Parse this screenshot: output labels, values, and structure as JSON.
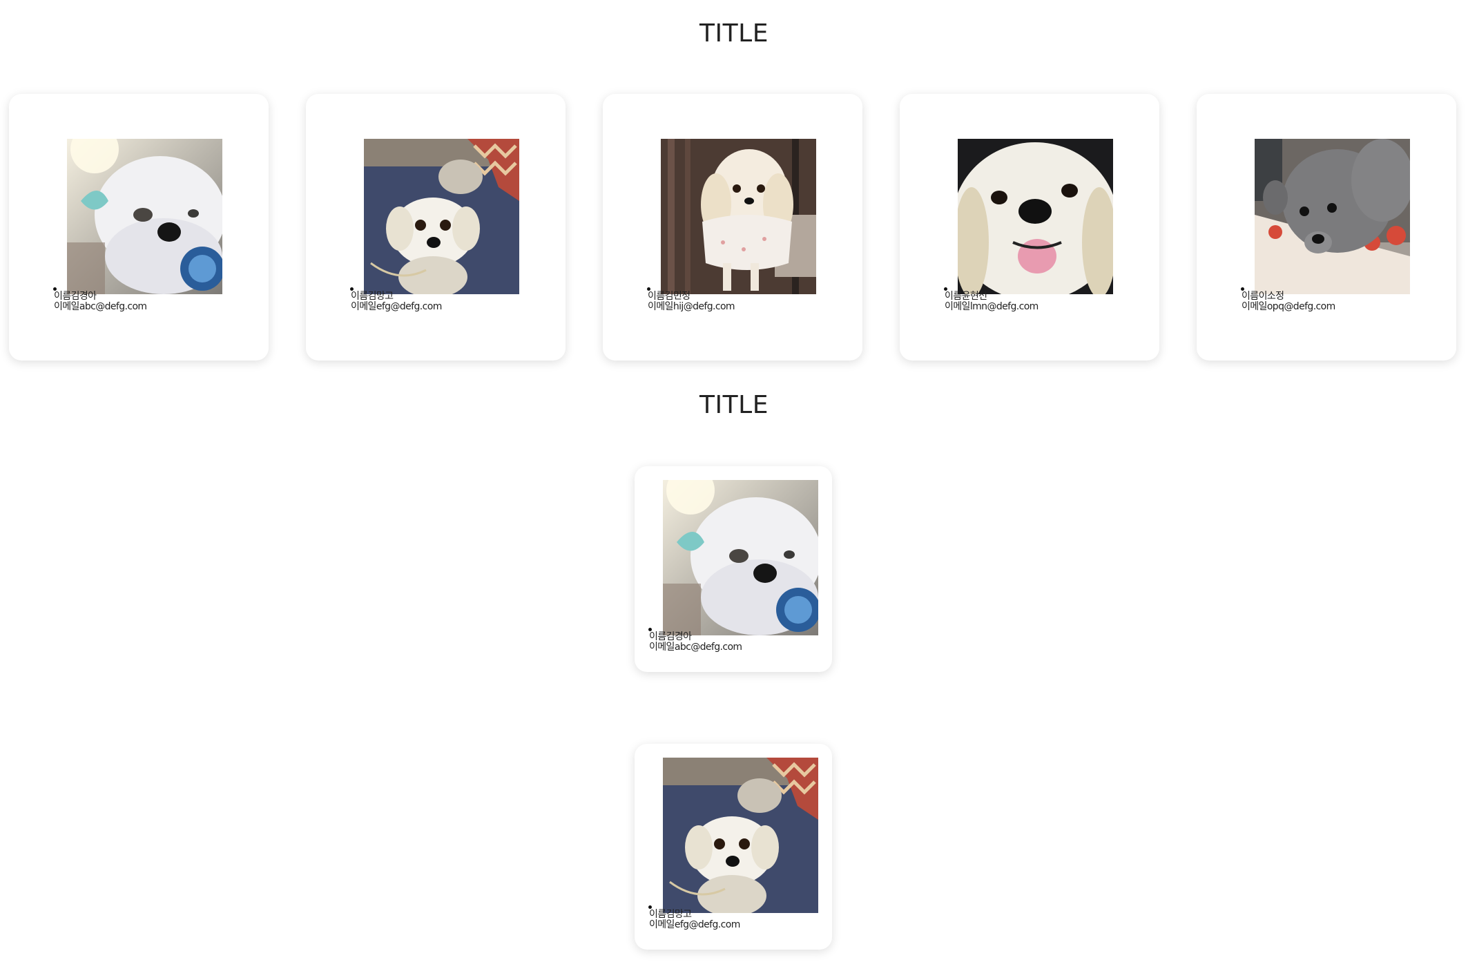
{
  "sections": [
    {
      "title": "TITLE",
      "cards": [
        {
          "name_label": "이름",
          "name": "김경아",
          "email_label": "이메일",
          "email": "abc@defg.com",
          "photo": "white maltese dog photo"
        },
        {
          "name_label": "이름",
          "name": "김망고",
          "email_label": "이메일",
          "email": "efg@defg.com",
          "photo": "white shih tzu dog photo"
        },
        {
          "name_label": "이름",
          "name": "김민정",
          "email_label": "이메일",
          "email": "hij@defg.com",
          "photo": "cream maltese dog photo"
        },
        {
          "name_label": "이름",
          "name": "윤현선",
          "email_label": "이메일",
          "email": "lmn@defg.com",
          "photo": "white dog tongue out photo"
        },
        {
          "name_label": "이름",
          "name": "이소정",
          "email_label": "이메일",
          "email": "opq@defg.com",
          "photo": "grey poodle dog photo"
        }
      ]
    },
    {
      "title": "TITLE",
      "cards": [
        {
          "name_label": "이름",
          "name": "김경아",
          "email_label": "이메일",
          "email": "abc@defg.com",
          "photo": "white maltese dog photo"
        },
        {
          "name_label": "이름",
          "name": "김망고",
          "email_label": "이메일",
          "email": "efg@defg.com",
          "photo": "white shih tzu dog photo"
        }
      ]
    }
  ]
}
